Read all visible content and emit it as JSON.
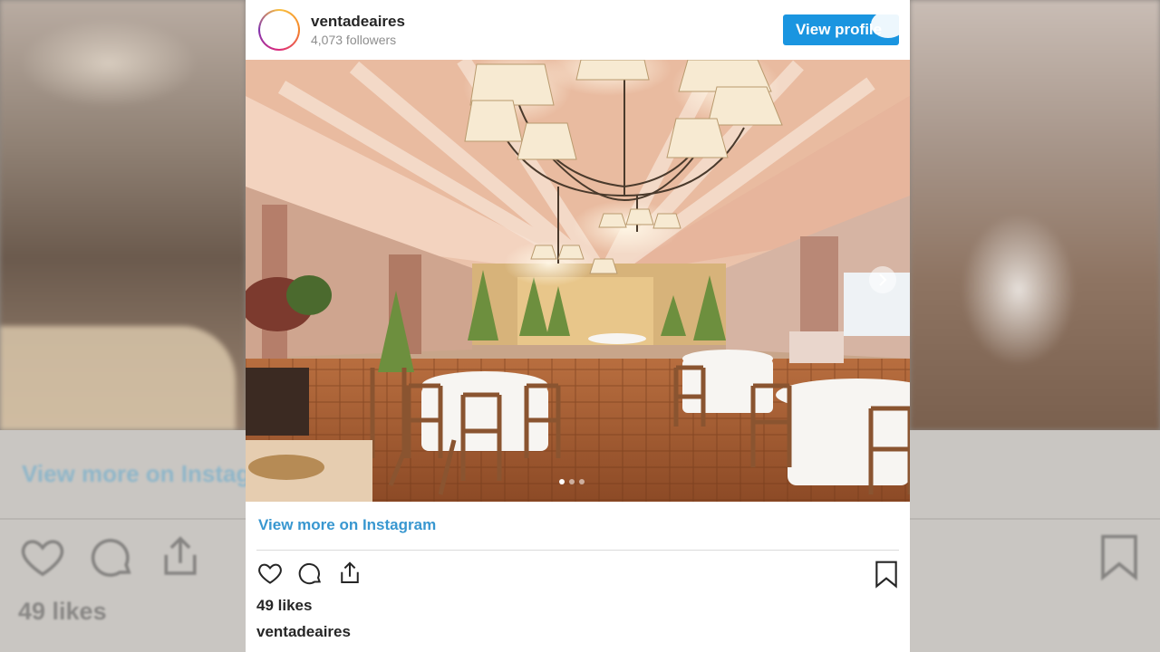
{
  "post": {
    "username": "ventadeaires",
    "followers": "4,073 followers",
    "view_profile_label": "View profile",
    "view_more_label": "View more on Instagram",
    "likes": "49 likes",
    "caption_username": "ventadeaires",
    "carousel": {
      "slide_count": 3,
      "active_slide": 1
    }
  },
  "background": {
    "view_more_label": "View more on Instagram",
    "likes": "49 likes"
  },
  "icons": {
    "like": "heart-icon",
    "comment": "comment-icon",
    "share": "share-icon",
    "save": "bookmark-icon",
    "next": "chevron-right-icon"
  },
  "colors": {
    "accent": "#1a95e0",
    "link": "#3897d0",
    "text": "#262626",
    "muted": "#8e8e8e"
  }
}
